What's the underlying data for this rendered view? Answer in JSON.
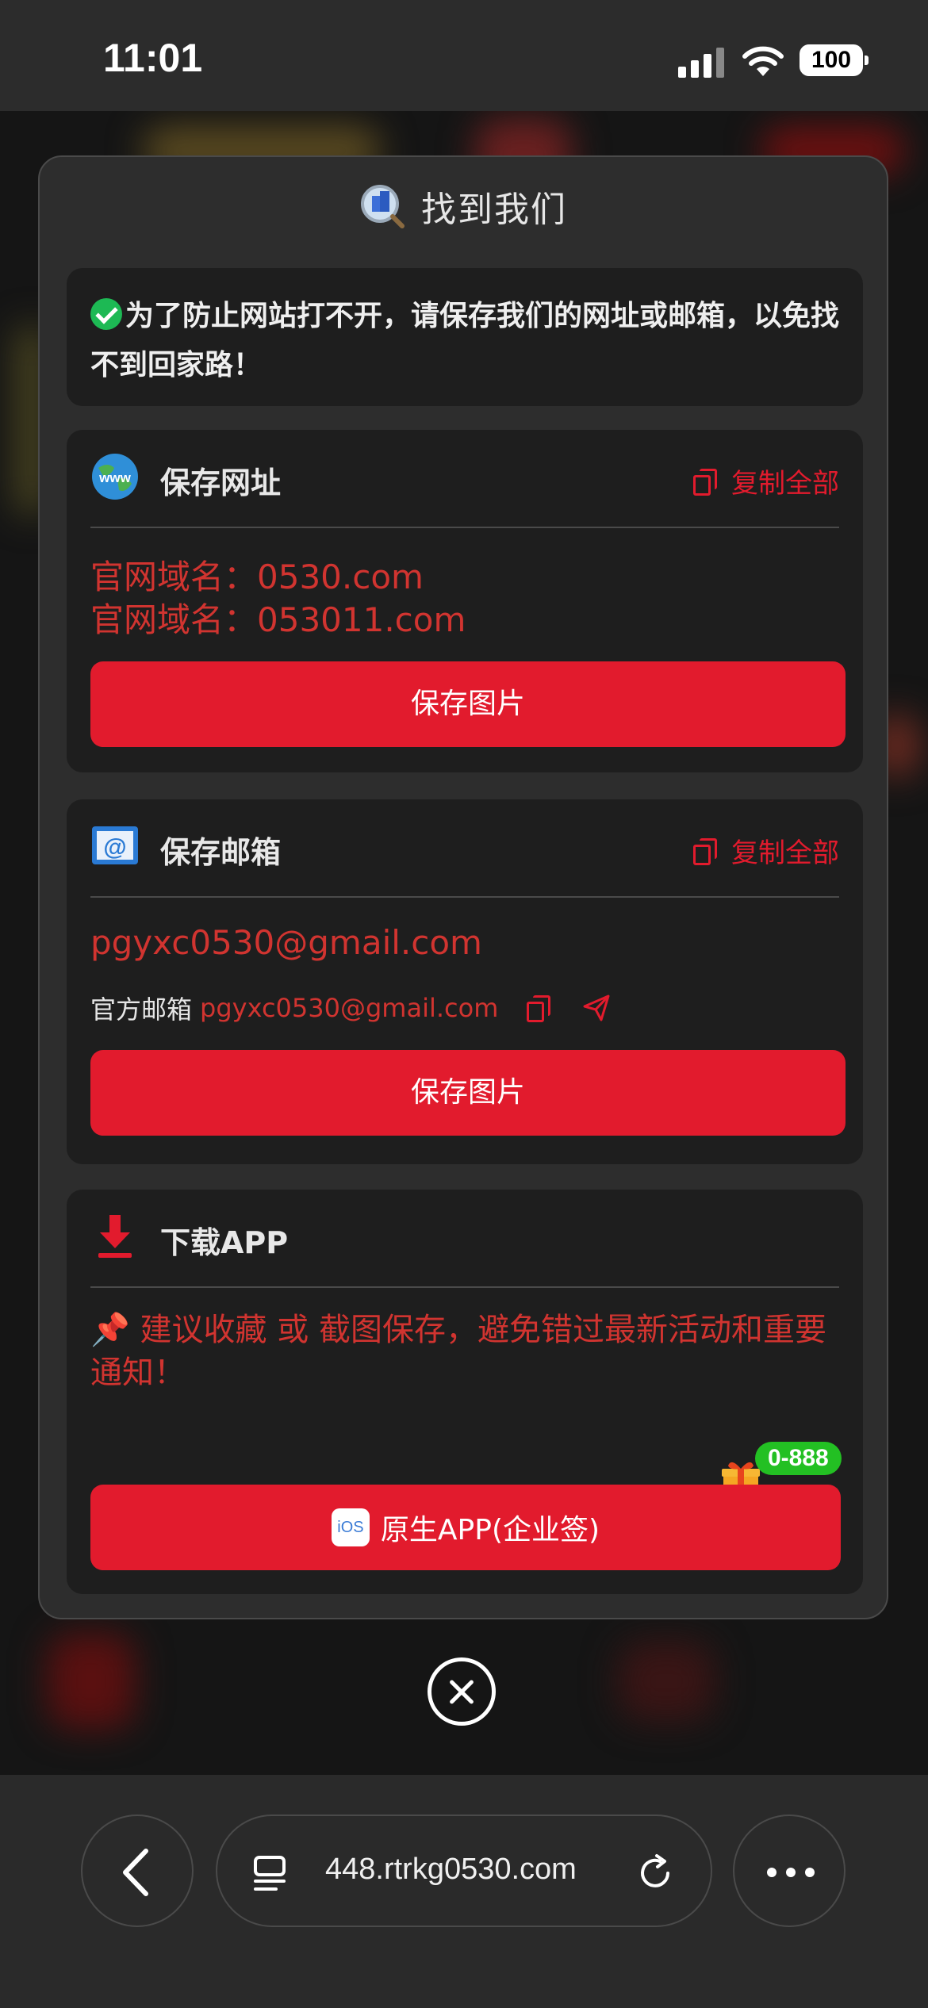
{
  "status": {
    "time": "11:01",
    "battery": "100"
  },
  "modal": {
    "title": "找到我们",
    "notice": "为了防止网站打不开，请保存我们的网址或邮箱，以免找不到回家路！"
  },
  "save_url": {
    "title": "保存网址",
    "copy_all": "复制全部",
    "domains": [
      "官网域名：0530.com",
      "官网域名：053011.com"
    ],
    "button": "保存图片"
  },
  "save_email": {
    "title": "保存邮箱",
    "copy_all": "复制全部",
    "email": "pgyxc0530@gmail.com",
    "label": "官方邮箱",
    "email_small": "pgyxc0530@gmail.com",
    "button": "保存图片"
  },
  "download": {
    "title": "下载APP",
    "tip": "📌 建议收藏 或 截图保存，避免错过最新活动和重要通知！",
    "badge": "0-888",
    "ios_label": "iOS",
    "button": "原生APP(企业签)"
  },
  "browser": {
    "url": "448.rtrkg0530.com"
  },
  "colors": {
    "accent": "#e21b2d",
    "text_red": "#d13430",
    "badge_green": "#23c023"
  }
}
